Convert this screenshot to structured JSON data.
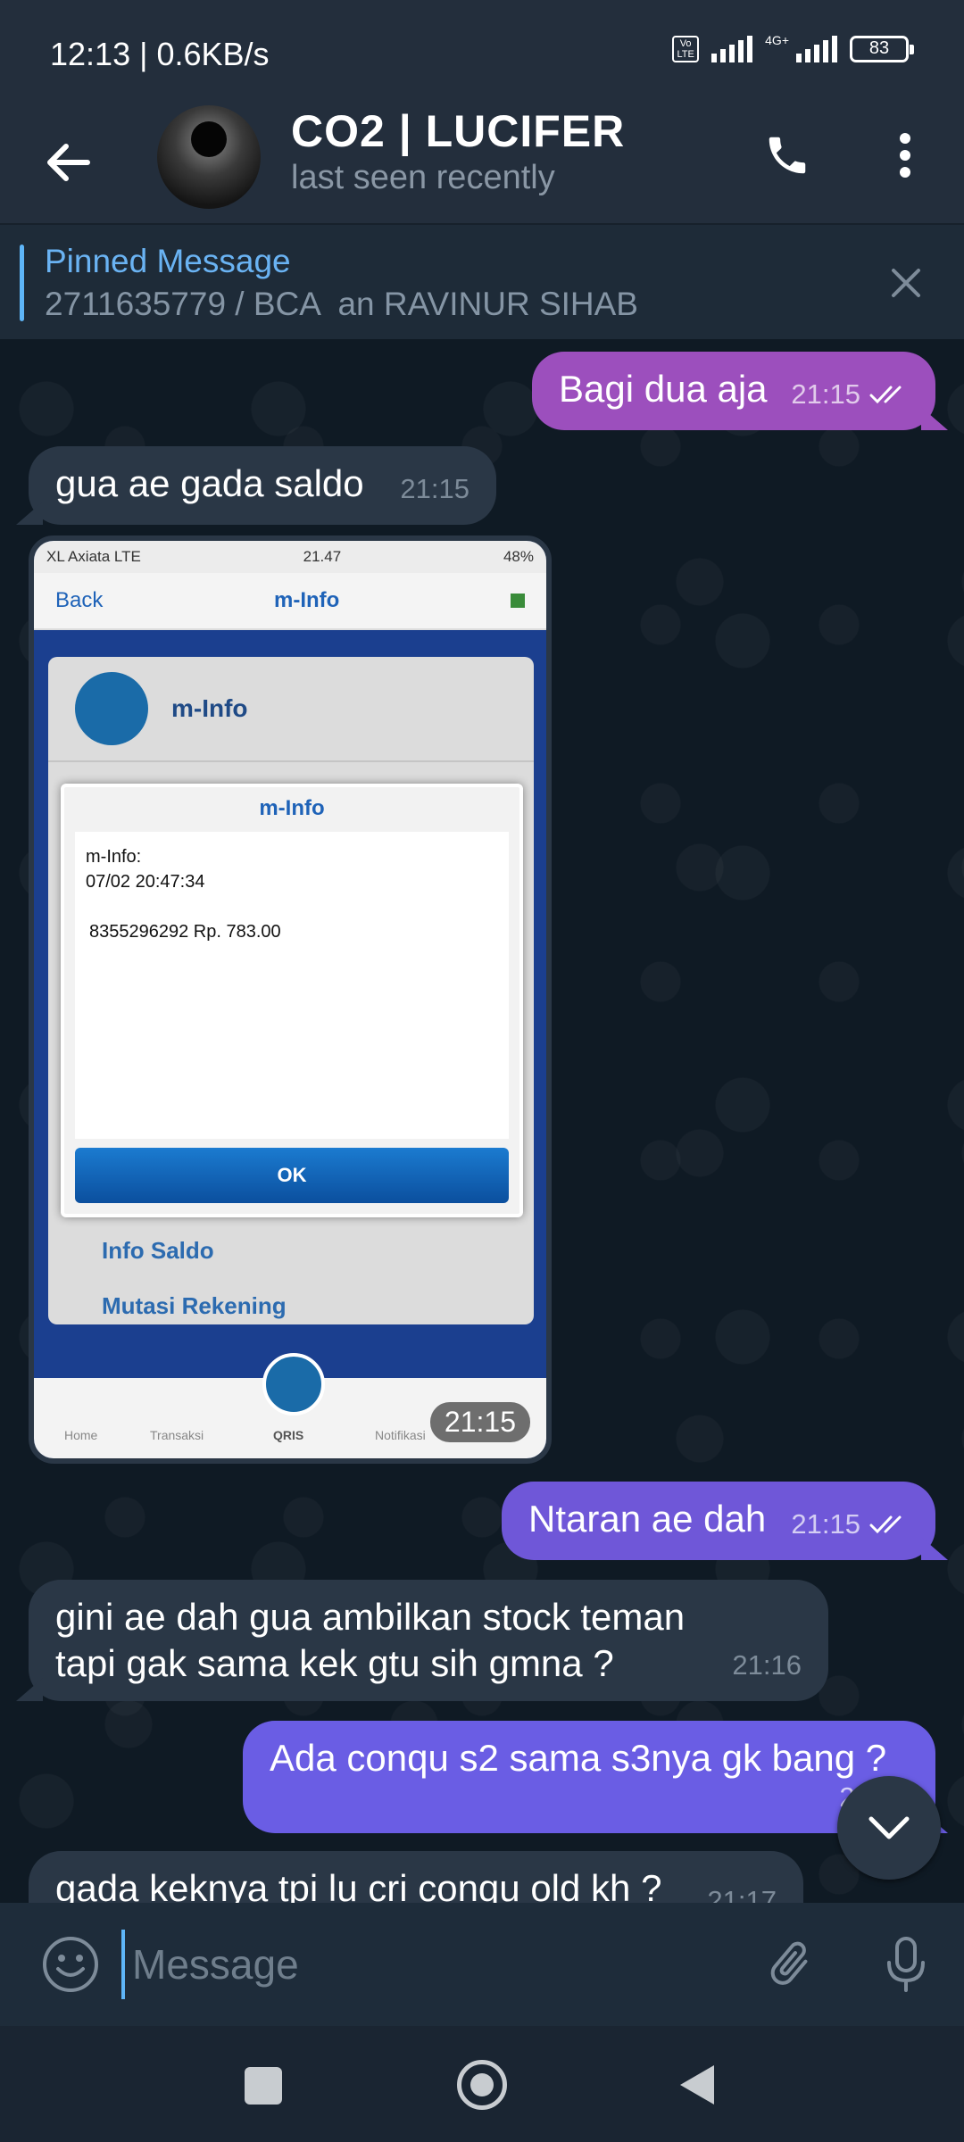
{
  "status_bar": {
    "time": "12:13 | 0.6KB/s",
    "volte": "Vo LTE",
    "network": "4G+",
    "battery": "83"
  },
  "header": {
    "contact_name": "CO2 | LUCIFER",
    "last_seen": "last seen recently",
    "icons": [
      "back-arrow-icon",
      "phone-icon",
      "more-vertical-icon"
    ]
  },
  "pinned": {
    "title": "Pinned Message",
    "text": "2711635779 / BCA  an RAVINUR SIHAB"
  },
  "messages": [
    {
      "dir": "out",
      "text": "Bagi dua aja",
      "time": "21:15",
      "read": true,
      "color": "#9c4fbd"
    },
    {
      "dir": "in",
      "text": "gua ae gada saldo",
      "time": "21:15"
    },
    {
      "dir": "in",
      "type": "photo",
      "time": "21:15",
      "screenshot": {
        "status_carrier": "XL Axiata  LTE",
        "status_time": "21.47",
        "status_battery": "48%",
        "nav_back": "Back",
        "nav_title": "m-Info",
        "card_title": "m-Info",
        "dialog_title": "m-Info",
        "dialog_line1": "m-Info:",
        "dialog_line2": "07/02 20:47:34",
        "dialog_line3": "8355296292 Rp. 783.00",
        "ok_label": "OK",
        "menu_item1": "Info Saldo",
        "menu_item2": "Mutasi Rekening",
        "tabs": [
          "Home",
          "Transaksi",
          "QRIS",
          "Notifikasi"
        ]
      }
    },
    {
      "dir": "out",
      "text": "Ntaran ae dah",
      "time": "21:15",
      "read": true,
      "color": "#6f57d8"
    },
    {
      "dir": "in",
      "text": "gini ae dah gua ambilkan stock teman tapi gak sama kek gtu sih gmna ?",
      "time": "21:16"
    },
    {
      "dir": "out",
      "text": "Ada conqu s2 sama s3nya gk bang ?",
      "time": "21:16",
      "color": "#6a5de4"
    },
    {
      "dir": "in",
      "text": "gada keknya tpi lu cri conqu old kh ?",
      "time": "21:17"
    }
  ],
  "composer": {
    "placeholder": "Message",
    "icons": [
      "emoji-icon",
      "attach-icon",
      "mic-icon"
    ]
  },
  "colors": {
    "header_bg": "#232e3c",
    "chat_bg": "#0f1a24",
    "incoming_bubble": "#2a3746",
    "accent": "#5eb5f7"
  }
}
